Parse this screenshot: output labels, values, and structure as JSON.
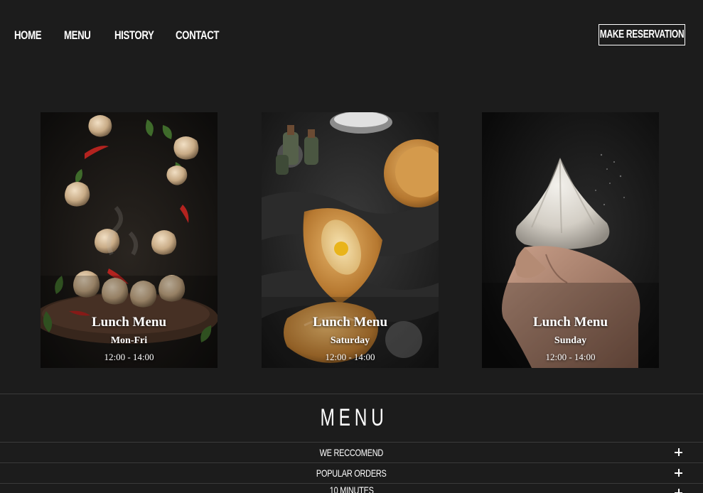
{
  "nav": {
    "items": [
      {
        "label": "HOME"
      },
      {
        "label": "MENU"
      },
      {
        "label": "HISTORY"
      },
      {
        "label": "CONTACT"
      }
    ],
    "reservation_label": "MAKE RESERVATION"
  },
  "cards": [
    {
      "title": "Lunch Menu",
      "days": "Mon-Fri",
      "hours": "12:00 - 14:00"
    },
    {
      "title": "Lunch Menu",
      "days": "Saturday",
      "hours": "12:00 - 14:00"
    },
    {
      "title": "Lunch Menu",
      "days": "Sunday",
      "hours": "12:00 - 14:00"
    }
  ],
  "menu": {
    "heading": "MENU",
    "categories": [
      {
        "label": "WE RECCOMEND"
      },
      {
        "label": "POPULAR ORDERS"
      },
      {
        "label": "10 MINUTES"
      }
    ]
  },
  "colors": {
    "background": "#1c1c1c",
    "text": "#ffffff",
    "divider": "#3a3a3a"
  }
}
